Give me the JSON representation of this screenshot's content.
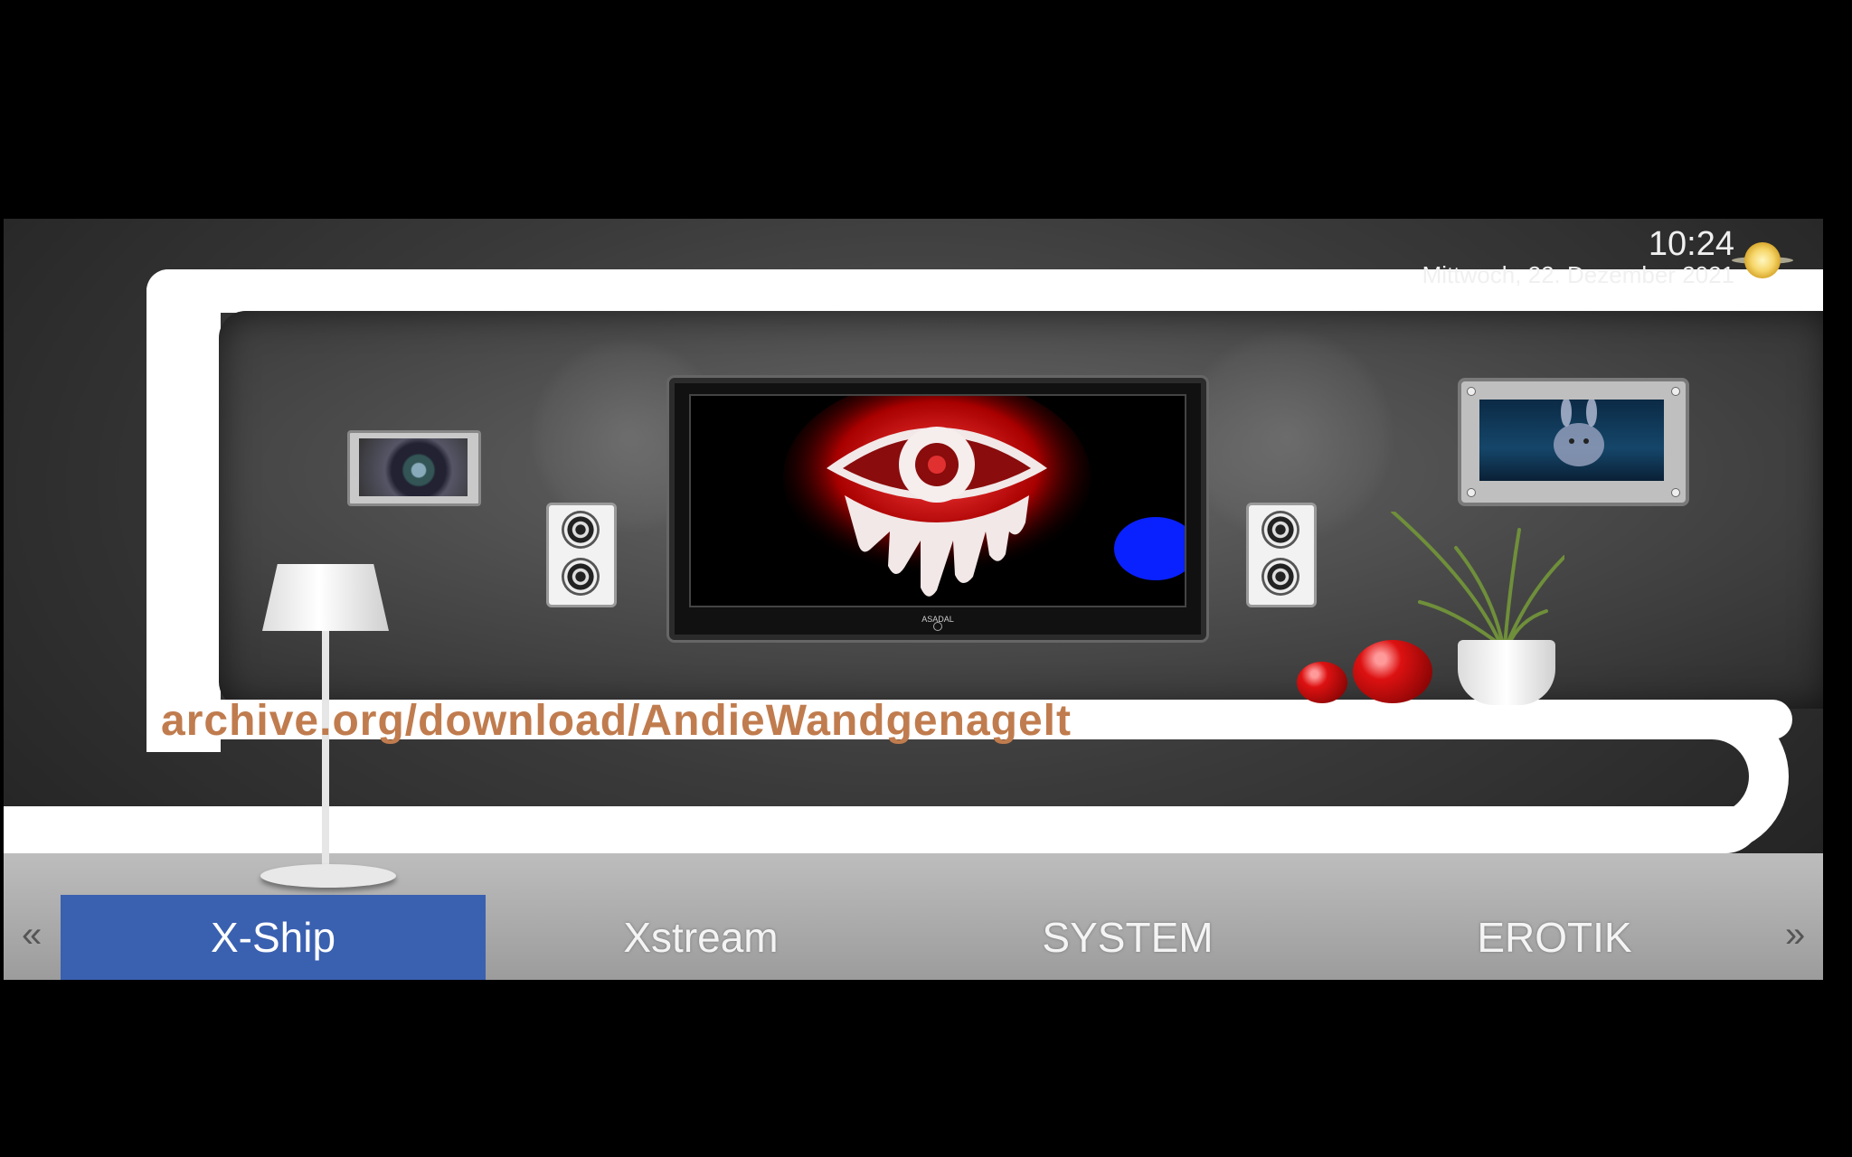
{
  "clock": {
    "time": "10:24",
    "date": "Mittwoch, 22. Dezember 2021"
  },
  "weather": {
    "icon": "sun-icon"
  },
  "tv": {
    "brand": "ASADAL"
  },
  "watermark": "archive.org/download/AndieWandgenagelt",
  "menu": {
    "prev_label": "«",
    "next_label": "»",
    "items": [
      {
        "label": "X-Ship",
        "active": true
      },
      {
        "label": "Xstream",
        "active": false
      },
      {
        "label": "SYSTEM",
        "active": false
      },
      {
        "label": "EROTIK",
        "active": false
      }
    ]
  },
  "colors": {
    "menu_active_bg": "#3a60b0",
    "watermark": "#c07c4e",
    "status_dot": "#0a21ff"
  }
}
